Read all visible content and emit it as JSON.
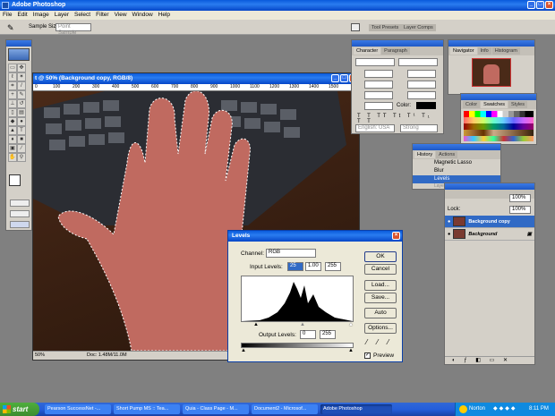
{
  "app": {
    "title": "Adobe Photoshop"
  },
  "menu": [
    "File",
    "Edit",
    "Image",
    "Layer",
    "Select",
    "Filter",
    "View",
    "Window",
    "Help"
  ],
  "options": {
    "sample_size_label": "Sample Size:",
    "sample_size_value": "Point Sample",
    "tabs": [
      "Tool Presets",
      "Layer Comps"
    ]
  },
  "doc": {
    "title": "t @ 50% (Background copy, RGB/8)",
    "status_zoom": "50%",
    "status_doc": "Doc: 1.48M/11.0M"
  },
  "char_palette": {
    "tabs": [
      "Character",
      "Paragraph"
    ],
    "lang": "English: USA",
    "aa": "Strong",
    "color_label": "Color:"
  },
  "navigator": {
    "tabs": [
      "Navigator",
      "Info",
      "Histogram"
    ]
  },
  "swatches": {
    "tabs": [
      "Color",
      "Swatches",
      "Styles"
    ]
  },
  "history": {
    "tabs": [
      "History",
      "Actions"
    ],
    "items": [
      "Magnetic Lasso",
      "Blur",
      "Levels",
      "Layer Copy"
    ]
  },
  "layers": {
    "opacity": "100%",
    "fill": "100%",
    "lock_label": "Lock:",
    "rows": [
      "Background copy",
      "Background"
    ]
  },
  "levels": {
    "title": "Levels",
    "channel_label": "Channel:",
    "channel_value": "RGB",
    "input_label": "Input Levels:",
    "input_values": [
      "25",
      "1.00",
      "255"
    ],
    "output_label": "Output Levels:",
    "output_values": [
      "0",
      "255"
    ],
    "buttons": [
      "OK",
      "Cancel",
      "Load...",
      "Save...",
      "Auto",
      "Options..."
    ],
    "preview": "Preview"
  },
  "taskbar": {
    "start": "start",
    "items": [
      "Pearson SuccessNet -...",
      "Short Pump MS :: Tea...",
      "Quia - Class Page - M...",
      "Document2 - Microsof...",
      "Adobe Photoshop"
    ],
    "norton": "Norton",
    "clock": "8:11 PM"
  },
  "ruler": [
    "0",
    "100",
    "200",
    "300",
    "400",
    "500",
    "600",
    "700",
    "800",
    "900",
    "1000",
    "1100",
    "1200",
    "1300",
    "1400",
    "1500"
  ],
  "colors": {
    "xp_blue": "#245edb",
    "taskbar_green": "#3c8c30",
    "skin": "#c06a60"
  }
}
